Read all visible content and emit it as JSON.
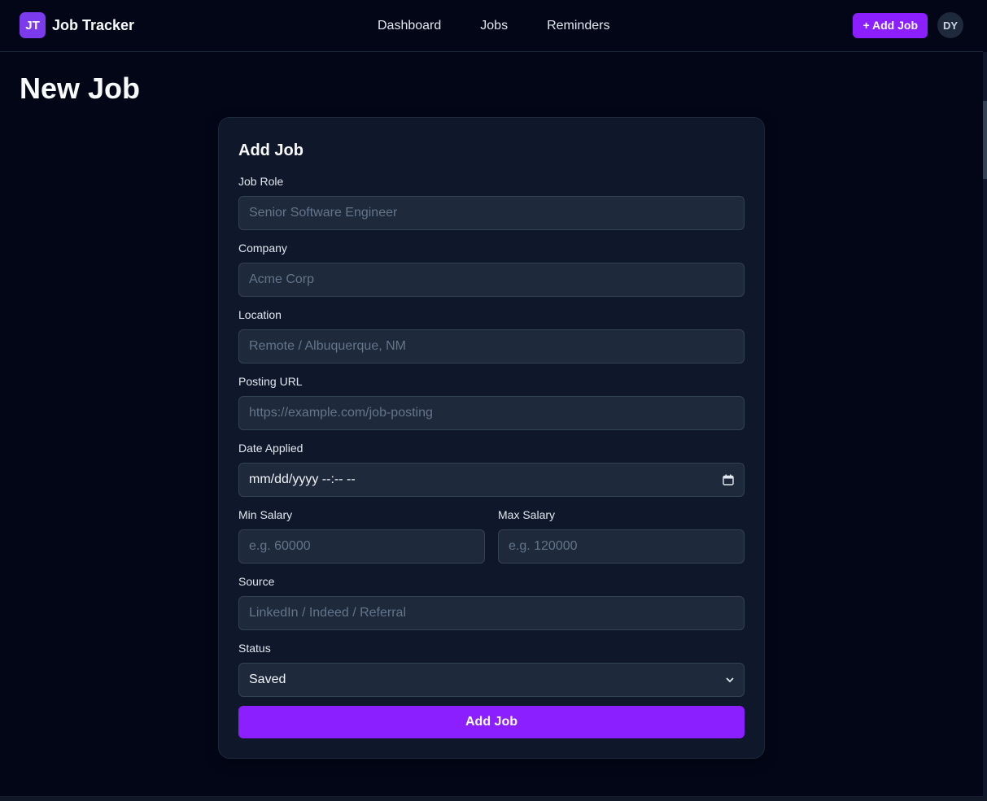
{
  "brand": {
    "logo": "JT",
    "name": "Job Tracker"
  },
  "nav": [
    "Dashboard",
    "Jobs",
    "Reminders"
  ],
  "header": {
    "add_job_label": "+ Add Job",
    "avatar_initials": "DY"
  },
  "page": {
    "title": "New Job"
  },
  "form": {
    "title": "Add Job",
    "job_role": {
      "label": "Job Role",
      "placeholder": "Senior Software Engineer"
    },
    "company": {
      "label": "Company",
      "placeholder": "Acme Corp"
    },
    "location": {
      "label": "Location",
      "placeholder": "Remote / Albuquerque, NM"
    },
    "posting_url": {
      "label": "Posting URL",
      "placeholder": "https://example.com/job-posting"
    },
    "date_applied": {
      "label": "Date Applied",
      "value": "mm/dd/yyyy --:-- --"
    },
    "min_salary": {
      "label": "Min Salary",
      "placeholder": "e.g. 60000"
    },
    "max_salary": {
      "label": "Max Salary",
      "placeholder": "e.g. 120000"
    },
    "source": {
      "label": "Source",
      "placeholder": "LinkedIn / Indeed / Referral"
    },
    "status": {
      "label": "Status",
      "value": "Saved"
    },
    "submit_label": "Add Job"
  },
  "icons": {
    "date": "calendar-icon",
    "select": "chevron-down-icon"
  },
  "colors": {
    "accent": "#8b1fff",
    "background": "#020617",
    "card": "#0f172a",
    "input": "#1e293b"
  }
}
